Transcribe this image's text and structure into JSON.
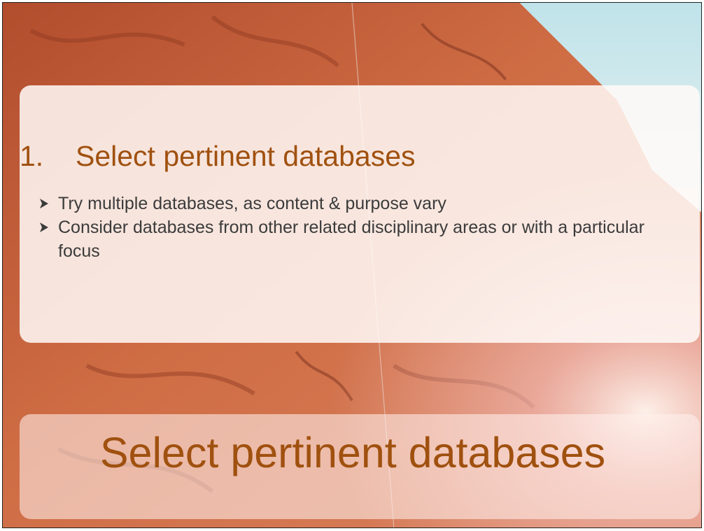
{
  "slide": {
    "heading_number": "1.",
    "heading_text": "Select pertinent databases",
    "bullets": [
      "Try multiple databases, as content & purpose vary",
      "Consider databases from other related disciplinary areas or with a particular focus"
    ],
    "caption": "Select pertinent databases"
  },
  "colors": {
    "heading": "#a0510f",
    "body_text": "#3b3b3b",
    "rock": "#c7623a",
    "sky": "#cfe6ea"
  },
  "icons": {
    "bullet": "arrow-bullet-icon"
  }
}
